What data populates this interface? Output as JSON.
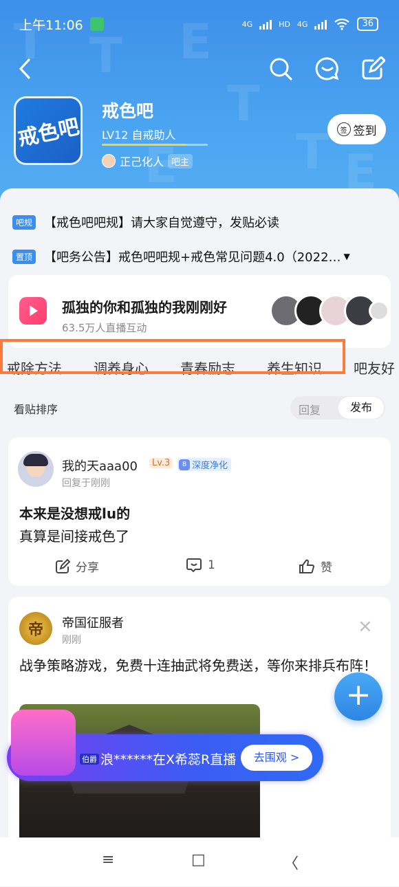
{
  "status": {
    "time": "上午11:06",
    "battery": "36",
    "net1": "4G",
    "net2": "HD",
    "net3": "4G"
  },
  "forum": {
    "name": "戒色吧",
    "logo_text": "戒色吧",
    "level": "LV12 自戒助人",
    "owner": "正己化人",
    "owner_tag": "吧主",
    "sign": "签到",
    "sign_icon": "签"
  },
  "notices": [
    {
      "tag": "吧规",
      "text": "【戒色吧吧规】请大家自觉遵守，发贴必读"
    },
    {
      "tag": "置顶",
      "text": "【吧务公告】戒色吧吧规+戒色常见问题4.0（2022…"
    }
  ],
  "live": {
    "title": "孤独的你和孤独的我刚刚好",
    "sub": "63.5万人直播互动"
  },
  "tabs": [
    "戒除方法",
    "调养身心",
    "青春励志",
    "养生知识",
    "吧友好"
  ],
  "sort": {
    "label": "看贴排序",
    "options": [
      "回复",
      "发布"
    ]
  },
  "post": {
    "user": "我的天aaa00",
    "level": "Lv.3",
    "badge_num": "8",
    "badge": "深度净化",
    "reply": "回复于刚刚",
    "title": "本来是没想戒lu的",
    "body": "真算是间接戒色了",
    "share": "分享",
    "comments": "1",
    "like": "赞"
  },
  "ad": {
    "avatar": "帝",
    "user": "帝国征服者",
    "time": "刚刚",
    "text": "战争策略游戏，免费十连抽武将免费送，等你来排兵布阵！",
    "close": "×"
  },
  "banner": {
    "tag": "伯爵",
    "text": "浪******在X希蕊R直播",
    "button": "去围观 >"
  },
  "fab": "+",
  "nav": [
    "≡",
    "□",
    "〈"
  ]
}
